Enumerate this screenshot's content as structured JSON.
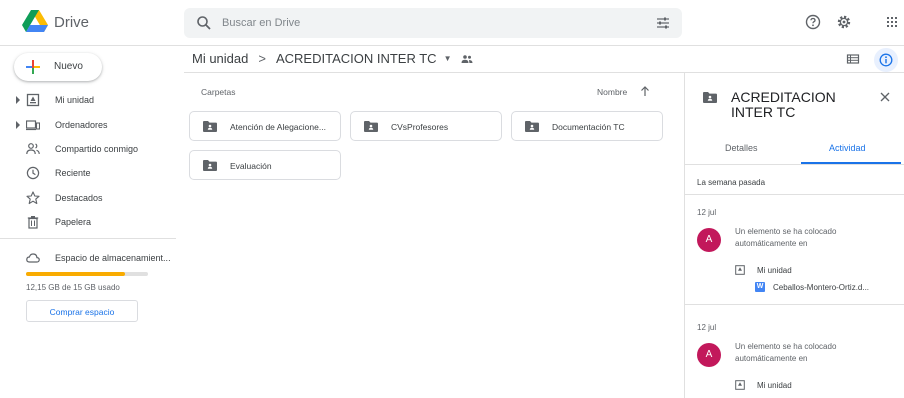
{
  "app": {
    "title": "Drive"
  },
  "search": {
    "placeholder": "Buscar en Drive"
  },
  "sidebar": {
    "new_label": "Nuevo",
    "items": [
      {
        "label": "Mi unidad",
        "icon": "my-drive-icon",
        "expandable": true
      },
      {
        "label": "Ordenadores",
        "icon": "computers-icon",
        "expandable": true
      },
      {
        "label": "Compartido conmigo",
        "icon": "shared-icon",
        "expandable": false
      },
      {
        "label": "Reciente",
        "icon": "clock-icon",
        "expandable": false
      },
      {
        "label": "Destacados",
        "icon": "star-icon",
        "expandable": false
      },
      {
        "label": "Papelera",
        "icon": "trash-icon",
        "expandable": false
      }
    ],
    "storage": {
      "label": "Espacio de almacenamient...",
      "usage_text": "12,15 GB de 15 GB usado",
      "used_fraction": 0.81,
      "buy_label": "Comprar espacio"
    }
  },
  "breadcrumb": {
    "root": "Mi unidad",
    "separator": ">",
    "current": "ACREDITACION INTER TC"
  },
  "main": {
    "section_label": "Carpetas",
    "sort_label": "Nombre",
    "folders": [
      {
        "name": "Atención de Alegacione..."
      },
      {
        "name": "CVsProfesores"
      },
      {
        "name": "Documentación TC"
      },
      {
        "name": "Evaluación"
      }
    ]
  },
  "details": {
    "title": "ACREDITACION INTER TC",
    "tabs": [
      "Detalles",
      "Actividad"
    ],
    "active_tab": "Actividad",
    "week_label": "La semana pasada",
    "activities": [
      {
        "date": "12 jul",
        "avatar": "A",
        "text": "Un elemento se ha colocado automáticamente en",
        "location": "Mi unidad",
        "file": "Ceballos-Montero-Ortiz.d...",
        "file_badge": "W"
      },
      {
        "date": "12 jul",
        "avatar": "A",
        "text": "Un elemento se ha colocado automáticamente en",
        "location": "Mi unidad"
      }
    ]
  },
  "colors": {
    "accent": "#1a73e8",
    "storage": "#f9ab00",
    "avatar": "#c2185b",
    "word": "#4285f4"
  }
}
